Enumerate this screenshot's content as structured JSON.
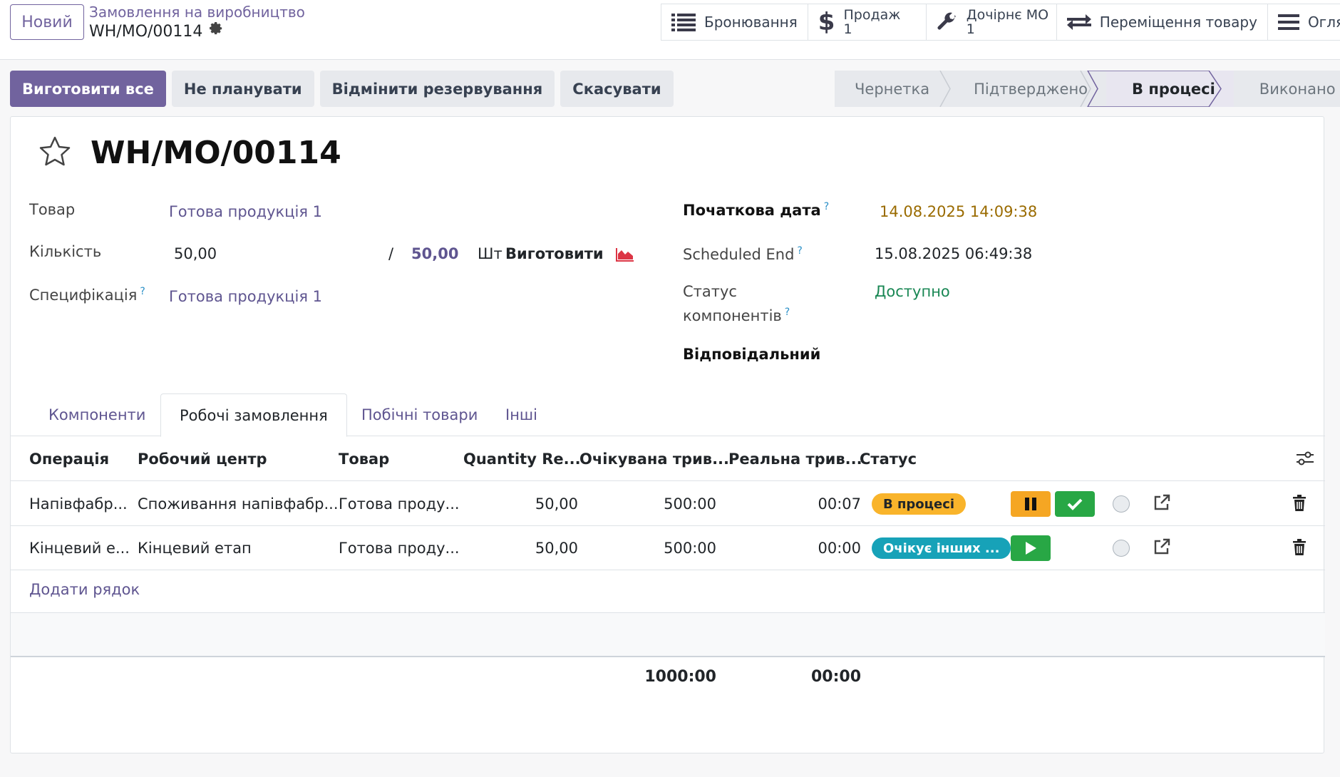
{
  "topbar": {
    "new_label": "Новий",
    "breadcrumb_parent": "Замовлення на виробництво",
    "breadcrumb_current": "WH/MO/00114",
    "smart_buttons": {
      "reservation": "Бронювання",
      "sale_label": "Продаж",
      "sale_count": "1",
      "child_mo_label": "Дочірнє МО",
      "child_mo_count": "1",
      "transfers": "Переміщення товару",
      "overview": "Огляд"
    }
  },
  "actions": {
    "produce_all": "Виготовити все",
    "unplan": "Не планувати",
    "unreserve": "Відмінити резервування",
    "cancel": "Скасувати"
  },
  "statusbar": {
    "draft": "Чернетка",
    "confirmed": "Підтверджено",
    "in_progress": "В процесі",
    "done": "Виконано",
    "active_color": "#e8e6f0"
  },
  "form": {
    "title": "WH/MO/00114",
    "product_label": "Товар",
    "product_value": "Готова продукція 1",
    "quantity_label": "Кількість",
    "quantity_value": "50,00",
    "quantity_sep": "/",
    "quantity_total": "50,00",
    "uom": "Шт",
    "produce_label": "Виготовити",
    "bom_label": "Специфікація",
    "bom_value": "Готова продукція 1",
    "start_label": "Початкова дата",
    "start_value": "14.08.2025 14:09:38",
    "end_label": "Scheduled End",
    "end_value": "15.08.2025 06:49:38",
    "comp_status_label_1": "Статус",
    "comp_status_label_2": "компонентів",
    "comp_status_value": "Доступно",
    "responsible_label": "Відповідальний",
    "help_mark": "?"
  },
  "tabs": [
    "Компоненти",
    "Робочі замовлення",
    "Побічні товари",
    "Інші"
  ],
  "table": {
    "headers": [
      "Операція",
      "Робочий центр",
      "Товар",
      "Quantity Re...",
      "Очікувана трив...",
      "Реальна трив...",
      "Статус"
    ],
    "rows": [
      {
        "operation": "Напівфабр...",
        "workcenter": "Споживання напівфабр...",
        "product": "Готова проду...",
        "qty": "50,00",
        "expected": "500:00",
        "real": "00:07",
        "status": "В процесі",
        "status_color": "#f9b42b"
      },
      {
        "operation": "Кінцевий е...",
        "workcenter": "Кінцевий етап",
        "product": "Готова проду...",
        "qty": "50,00",
        "expected": "500:00",
        "real": "00:00",
        "status": "Очікує інших ...",
        "status_color": "#17a2b8"
      }
    ],
    "add_line": "Додати рядок",
    "total_expected": "1000:00",
    "total_real": "00:00"
  },
  "colors": {
    "brand": "#71639e",
    "link": "#5f5590",
    "date_warning": "#9a6b00",
    "available": "#198754",
    "pause_btn": "#f5a623",
    "done_btn": "#28a745",
    "start_btn": "#28a745"
  }
}
